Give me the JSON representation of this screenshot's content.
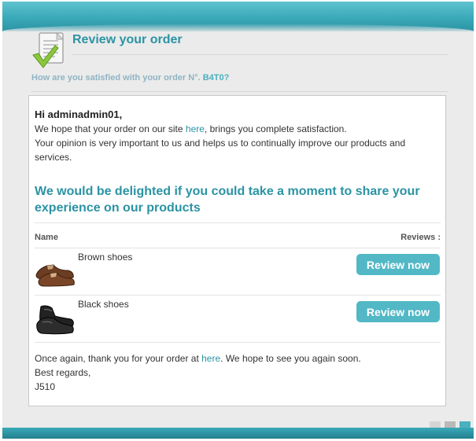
{
  "header": {
    "title": "Review your order",
    "subtitle_prefix": "How are you satisfied with your order N°.",
    "order_ref": "B4T0?"
  },
  "email": {
    "greeting": "Hi adminadmin01,",
    "intro_before": "We hope that your order on our site ",
    "intro_link": "here",
    "intro_after": ", brings you complete satisfaction.",
    "intro_line2": "Your opinion is very important to us and helps us to continually improve our products and services.",
    "headline": "We would be delighted if you could take a moment to share your experience on our products",
    "col_name": "Name",
    "col_reviews": "Reviews :",
    "products": [
      {
        "name": "Brown shoes",
        "button": "Review now",
        "icon": "brown-shoes-icon"
      },
      {
        "name": "Black shoes",
        "button": "Review now",
        "icon": "black-shoes-icon"
      }
    ],
    "closing_before": "Once again, thank you for your order at ",
    "closing_link": "here",
    "closing_after": ". We hope to see you again soon.",
    "regards": "Best regards,",
    "signature": "J510"
  },
  "icons": {
    "header": "document-checkmark-icon"
  },
  "colors": {
    "accent": "#2b93a3",
    "button": "#52b8c6",
    "band": "#3aa9b8"
  }
}
